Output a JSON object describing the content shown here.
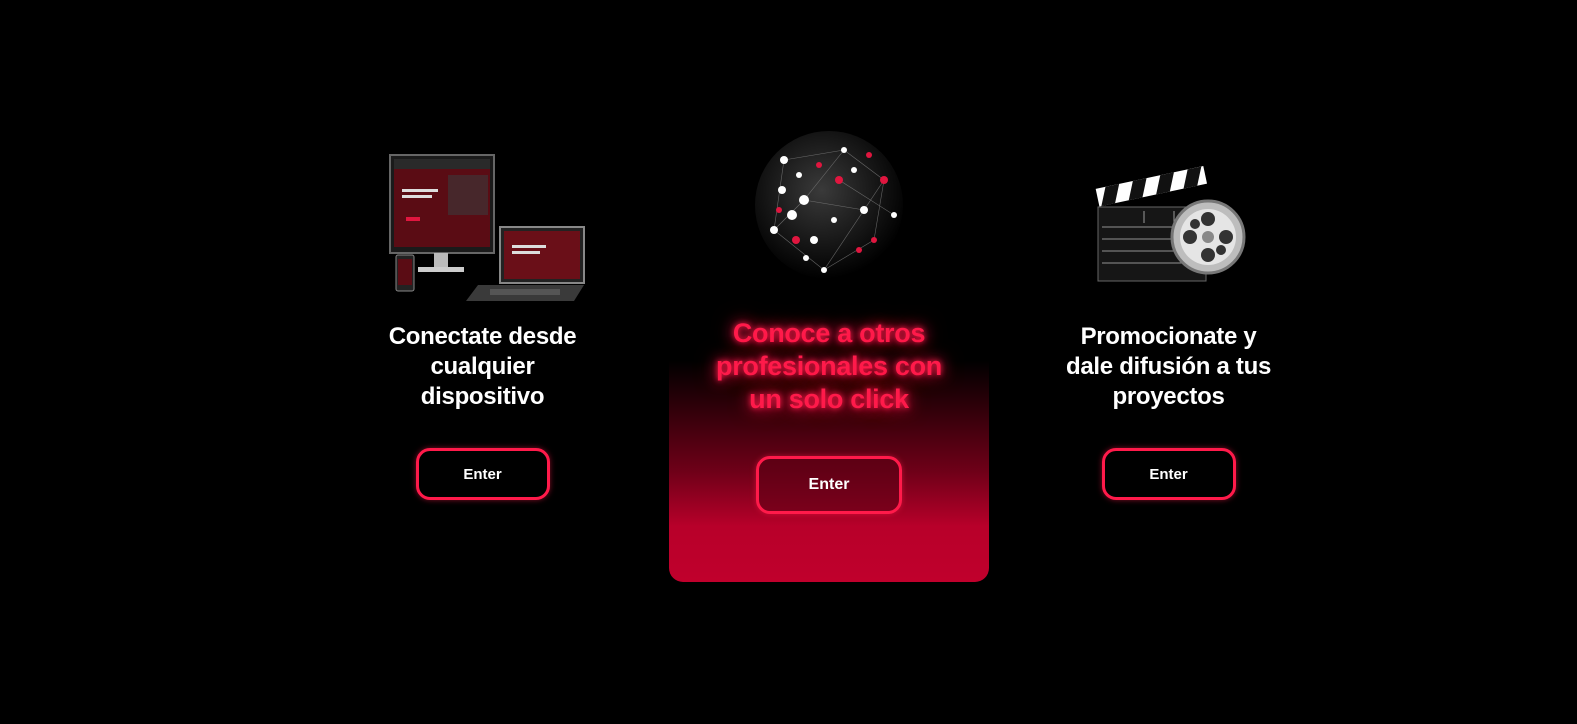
{
  "cards": [
    {
      "title": "Conectate desde cualquier dispositivo",
      "button_label": "Enter",
      "illustration_icon": "devices-icon"
    },
    {
      "title": "Conoce a otros profesionales con un solo click",
      "button_label": "Enter",
      "illustration_icon": "network-globe-icon"
    },
    {
      "title": "Promocionate y dale difusión a tus proyectos",
      "button_label": "Enter",
      "illustration_icon": "clapperboard-film-reel-icon"
    }
  ],
  "colors": {
    "accent": "#ff1a4a",
    "accent_dark": "#c0002c",
    "background": "#000000"
  }
}
